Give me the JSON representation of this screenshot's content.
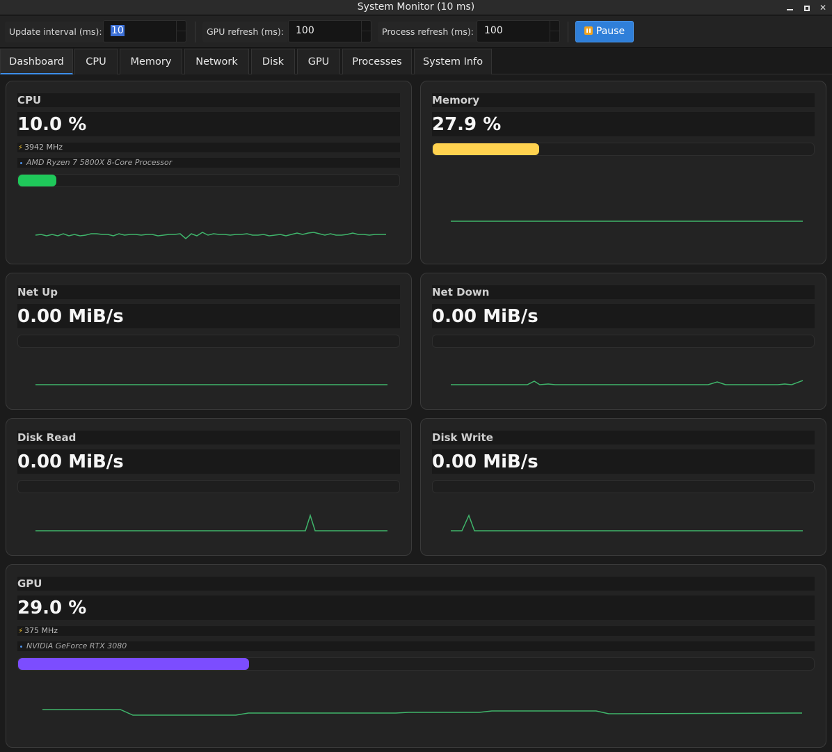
{
  "window": {
    "title": "System Monitor (10 ms)"
  },
  "toolbar": {
    "update_interval_label": "Update interval (ms):",
    "update_interval_value": "10",
    "gpu_refresh_label": "GPU refresh (ms):",
    "gpu_refresh_value": "100",
    "process_refresh_label": "Process refresh (ms):",
    "process_refresh_value": "100",
    "pause_label": "Pause"
  },
  "tabs": [
    "Dashboard",
    "CPU",
    "Memory",
    "Network",
    "Disk",
    "GPU",
    "Processes",
    "System Info"
  ],
  "cards": {
    "cpu": {
      "title": "CPU",
      "value": "10.0 %",
      "freq": "3942 MHz",
      "model": "AMD Ryzen 7 5800X 8-Core Processor",
      "percent": 10.0,
      "color": "#1fc85a"
    },
    "memory": {
      "title": "Memory",
      "value": "27.9 %",
      "percent": 27.9,
      "color": "#ffd24f"
    },
    "net_up": {
      "title": "Net Up",
      "value": "0.00 MiB/s",
      "percent": 0
    },
    "net_down": {
      "title": "Net Down",
      "value": "0.00 MiB/s",
      "percent": 0
    },
    "disk_read": {
      "title": "Disk Read",
      "value": "0.00 MiB/s",
      "percent": 0
    },
    "disk_write": {
      "title": "Disk Write",
      "value": "0.00 MiB/s",
      "percent": 0
    },
    "gpu": {
      "title": "GPU",
      "value": "29.0 %",
      "freq": "375 MHz",
      "model": "NVIDIA GeForce RTX 3080",
      "percent": 29.0,
      "color": "#7c4dff"
    }
  },
  "colors": {
    "sparkline": "#3fb56b",
    "accent": "#2f7fd9"
  }
}
